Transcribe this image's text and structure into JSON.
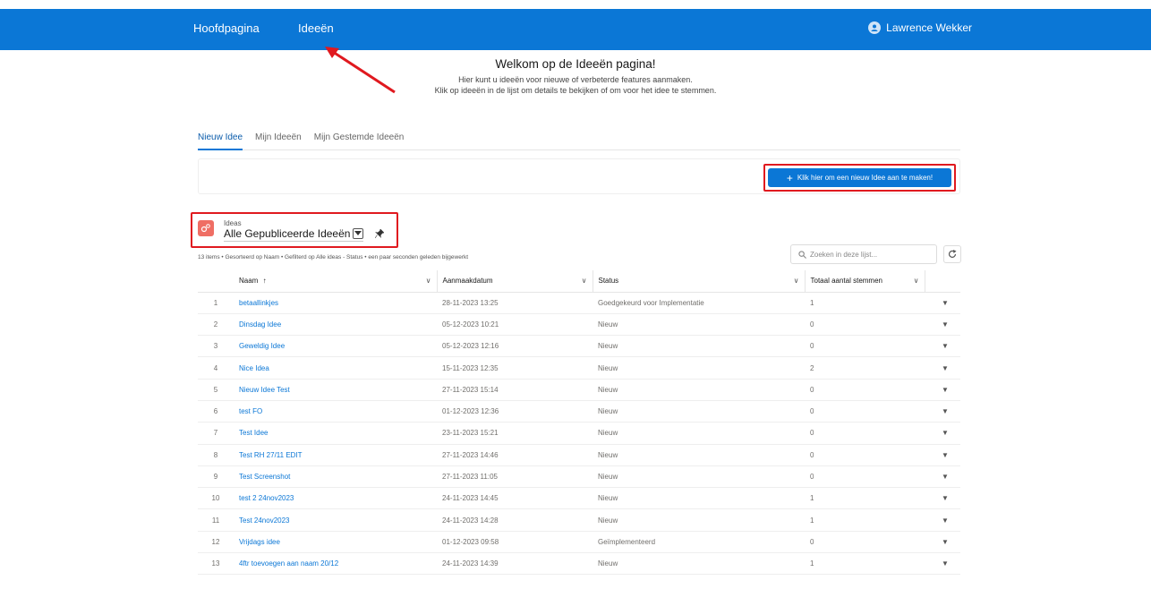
{
  "nav": {
    "home": "Hoofdpagina",
    "ideas": "Ideeën",
    "user": "Lawrence Wekker"
  },
  "welcome": {
    "title": "Welkom op de Ideeën pagina!",
    "line1": "Hier kunt u ideeën voor nieuwe of verbeterde features aanmaken.",
    "line2": "Klik op ideeën in de lijst om details te bekijken of om voor het idee te stemmen."
  },
  "tabs": [
    "Nieuw Idee",
    "Mijn Ideeën",
    "Mijn Gestemde Ideeën"
  ],
  "new_button": "Klik hier om een nieuw Idee aan te maken!",
  "list": {
    "object": "Ideas",
    "view": "Alle Gepubliceerde Ideeën",
    "meta": "13 items • Gesorteerd op Naam • Gefilterd op Alle ideas - Status • een paar seconden geleden bijgewerkt",
    "search_placeholder": "Zoeken in deze lijst...",
    "columns": {
      "name": "Naam",
      "date": "Aanmaakdatum",
      "status": "Status",
      "votes": "Totaal aantal stemmen"
    },
    "rows": [
      {
        "n": "1",
        "name": "betaallinkjes",
        "date": "28-11-2023 13:25",
        "status": "Goedgekeurd voor Implementatie",
        "votes": "1"
      },
      {
        "n": "2",
        "name": "Dinsdag Idee",
        "date": "05-12-2023 10:21",
        "status": "Nieuw",
        "votes": "0"
      },
      {
        "n": "3",
        "name": "Geweldig Idee",
        "date": "05-12-2023 12:16",
        "status": "Nieuw",
        "votes": "0"
      },
      {
        "n": "4",
        "name": "Nice Idea",
        "date": "15-11-2023 12:35",
        "status": "Nieuw",
        "votes": "2"
      },
      {
        "n": "5",
        "name": "Nieuw Idee Test",
        "date": "27-11-2023 15:14",
        "status": "Nieuw",
        "votes": "0"
      },
      {
        "n": "6",
        "name": "test FO",
        "date": "01-12-2023 12:36",
        "status": "Nieuw",
        "votes": "0"
      },
      {
        "n": "7",
        "name": "Test Idee",
        "date": "23-11-2023 15:21",
        "status": "Nieuw",
        "votes": "0"
      },
      {
        "n": "8",
        "name": "Test RH 27/11 EDIT",
        "date": "27-11-2023 14:46",
        "status": "Nieuw",
        "votes": "0"
      },
      {
        "n": "9",
        "name": "Test Screenshot",
        "date": "27-11-2023 11:05",
        "status": "Nieuw",
        "votes": "0"
      },
      {
        "n": "10",
        "name": "test 2 24nov2023",
        "date": "24-11-2023 14:45",
        "status": "Nieuw",
        "votes": "1"
      },
      {
        "n": "11",
        "name": "Test 24nov2023",
        "date": "24-11-2023 14:28",
        "status": "Nieuw",
        "votes": "1"
      },
      {
        "n": "12",
        "name": "Vrijdags idee",
        "date": "01-12-2023 09:58",
        "status": "Geïmplementeerd",
        "votes": "0"
      },
      {
        "n": "13",
        "name": "4ftr toevoegen aan naam 20/12",
        "date": "24-11-2023 14:39",
        "status": "Nieuw",
        "votes": "1"
      }
    ]
  },
  "colors": {
    "brand": "#0b77d6",
    "highlight": "#e0191f",
    "list_icon": "#ef6e64"
  }
}
